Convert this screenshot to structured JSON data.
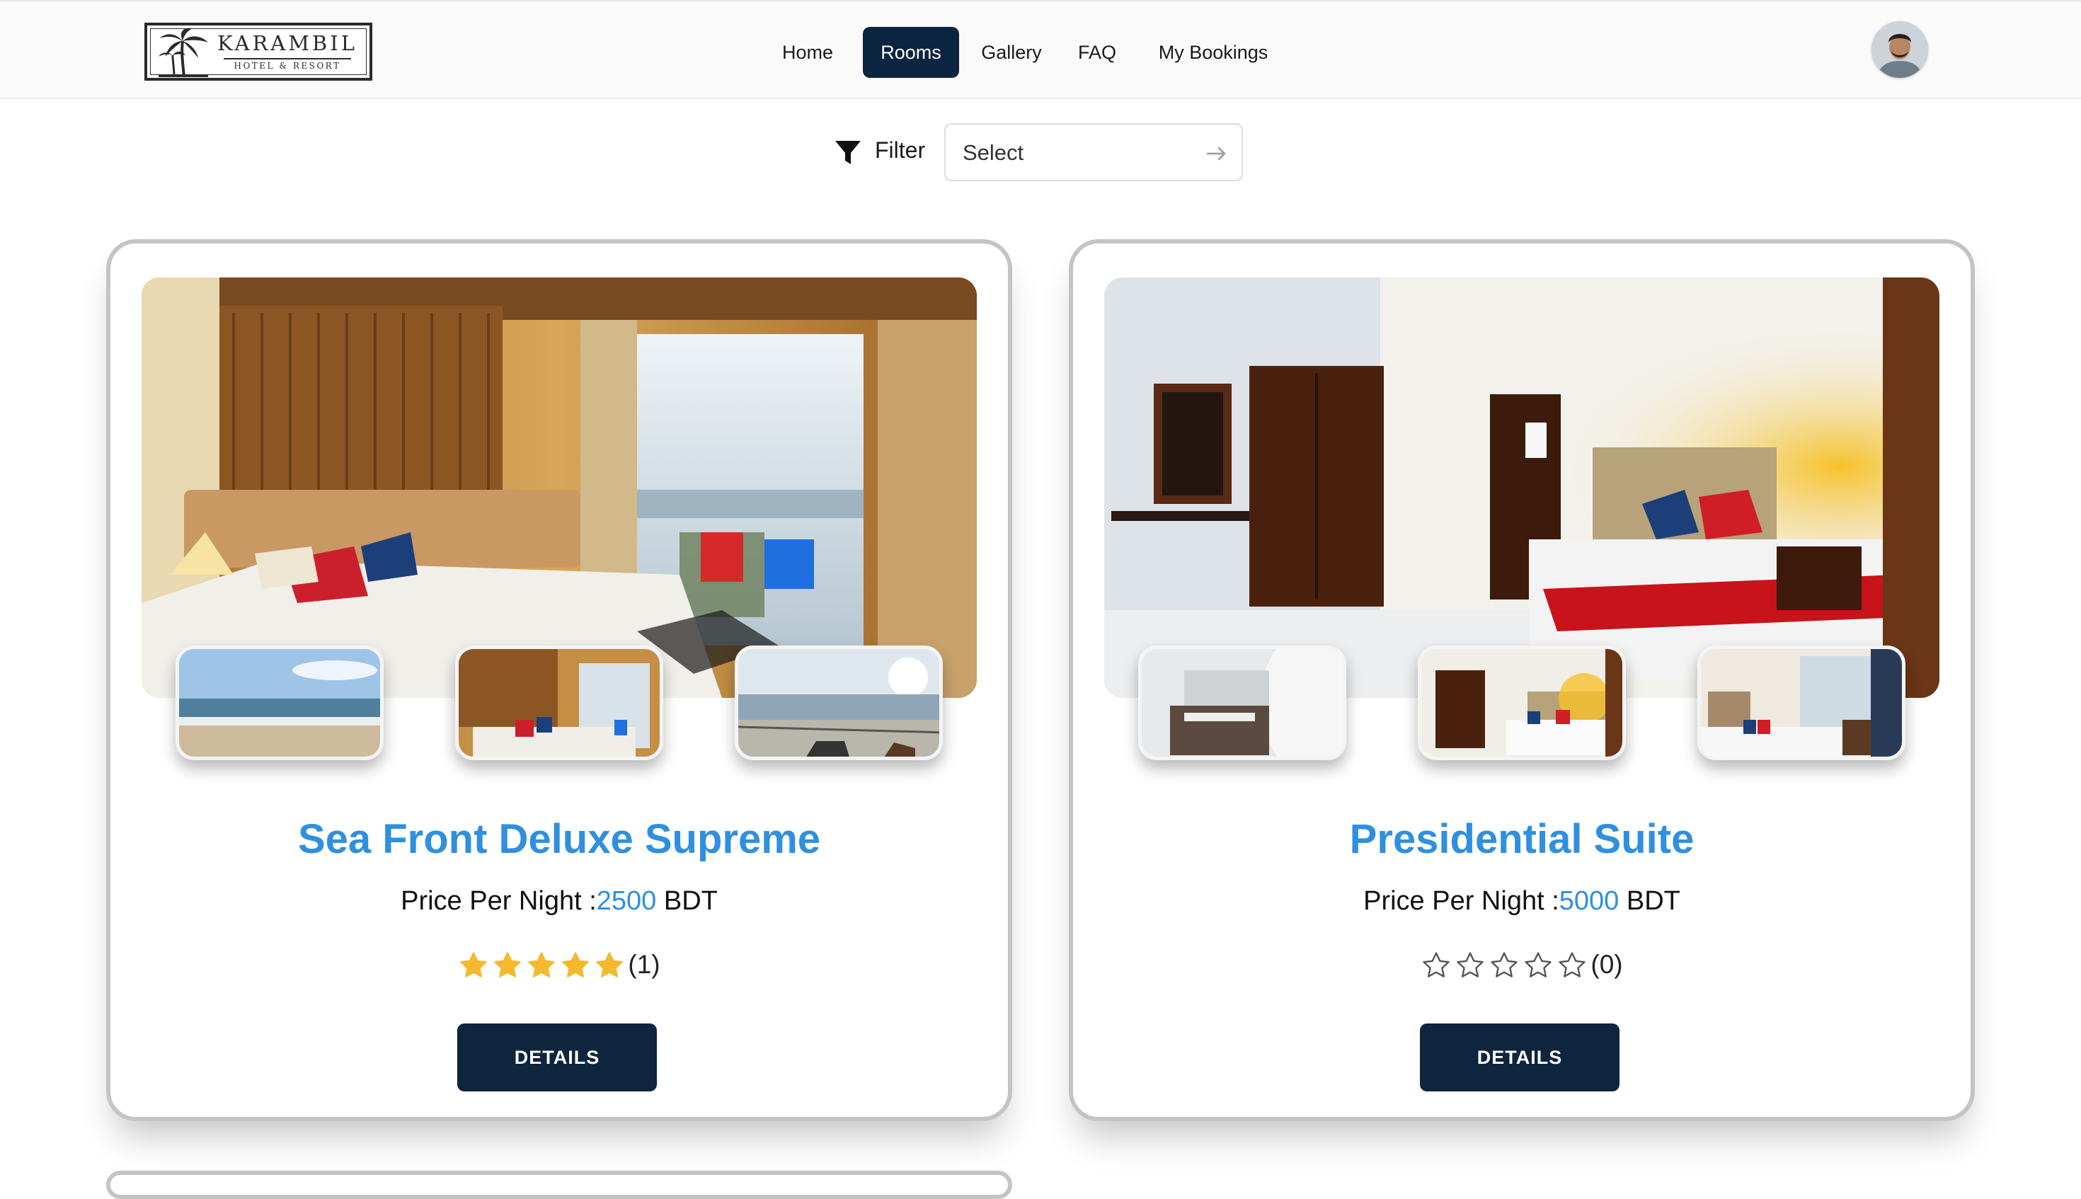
{
  "brand": {
    "name": "KARAMBIL",
    "tagline": "HOTEL & RESORT"
  },
  "nav": {
    "items": [
      {
        "label": "Home",
        "active": false
      },
      {
        "label": "Rooms",
        "active": true
      },
      {
        "label": "Gallery",
        "active": false
      },
      {
        "label": "FAQ",
        "active": false
      },
      {
        "label": "My Bookings",
        "active": false
      }
    ]
  },
  "filter": {
    "label": "Filter",
    "value": "Select"
  },
  "price_prefix": "Price Per Night :",
  "currency": "BDT",
  "colors": {
    "accent": "#2f8fe0",
    "navy": "#0f243d",
    "star": "#f5b82e"
  },
  "rooms": [
    {
      "title": "Sea Front Deluxe Supreme",
      "price": "2500",
      "rating": 5,
      "rating_count": "(1)",
      "details_label": "DETAILS"
    },
    {
      "title": "Presidential Suite",
      "price": "5000",
      "rating": 0,
      "rating_count": "(0)",
      "details_label": "DETAILS"
    }
  ]
}
